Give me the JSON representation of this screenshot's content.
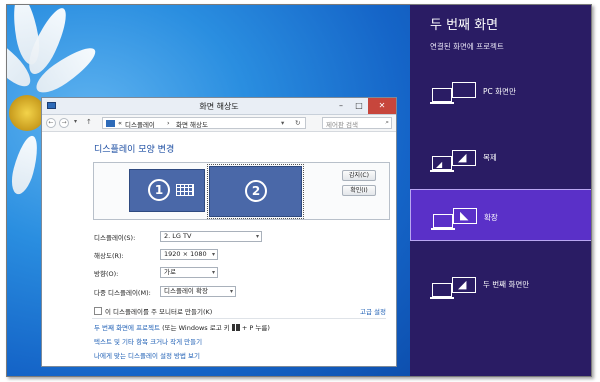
{
  "window": {
    "title": "화면 해상도",
    "breadcrumb_1": "디스플레이",
    "breadcrumb_sep": "›",
    "breadcrumb_2": "화면 해상도",
    "search_placeholder": "제어판 검색"
  },
  "main": {
    "heading": "디스플레이 모양 변경",
    "monitor_1": "1",
    "monitor_2": "2",
    "detect_button": "감지(C)",
    "identify_button": "확인(I)",
    "display_label": "디스플레이(S):",
    "display_value": "2. LG TV",
    "resolution_label": "해상도(R):",
    "resolution_value": "1920 × 1080",
    "orientation_label": "방향(O):",
    "orientation_value": "가로",
    "multi_label": "다중 디스플레이(M):",
    "multi_value": "디스플레이 확장",
    "primary_checkbox": "이 디스플레이를 주 모니터로 만들기(K)",
    "advanced_link": "고급 설정",
    "link_project": "두 번째 화면에 프로젝트",
    "link_project_hint_1": "(또는 Windows 로고 키",
    "link_project_hint_2": "+ P 누름)",
    "link_text_size": "텍스트 및 기타 항목 크거나 작게 만들기",
    "link_settings": "나에게 맞는 디스플레이 설정 방법 보기"
  },
  "panel": {
    "title": "두 번째 화면",
    "subtitle": "연결된 화면에 프로젝트",
    "options": [
      {
        "label": "PC 화면만"
      },
      {
        "label": "복제"
      },
      {
        "label": "확장"
      },
      {
        "label": "두 번째 화면만"
      }
    ]
  },
  "colors": {
    "panel_bg": "#2a1c64",
    "panel_active": "#5a30c8",
    "link": "#1e5fb5",
    "heading": "#1e4fa3"
  }
}
